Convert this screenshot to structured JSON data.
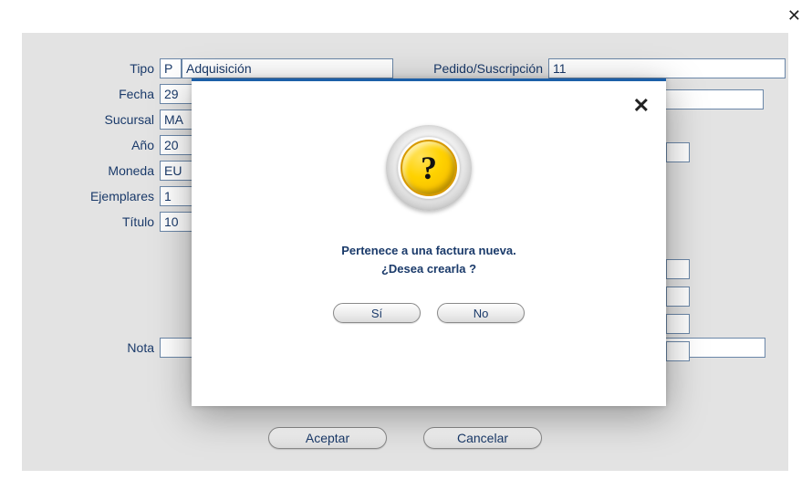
{
  "page": {
    "close_glyph": "✕"
  },
  "form": {
    "tipo_label": "Tipo",
    "tipo_value": "P",
    "tipo_desc": "Adquisición",
    "pedido_label": "Pedido/Suscripción",
    "pedido_value": "11",
    "fecha_label": "Fecha",
    "fecha_value": "29",
    "sucursal_label": "Sucursal",
    "sucursal_value": "MA",
    "ano_label": "Año",
    "ano_value": "20",
    "moneda_label": "Moneda",
    "moneda_value": "EU",
    "ejemplares_label": "Ejemplares",
    "ejemplares_value": "1",
    "titulo_label": "Título",
    "titulo_value": "10",
    "nota_label": "Nota",
    "nota_value": ""
  },
  "buttons": {
    "aceptar": "Aceptar",
    "cancelar": "Cancelar"
  },
  "dialog": {
    "line1": "Pertenece a una factura nueva.",
    "line2": "¿Desea crearla ?",
    "yes": "Sí",
    "no": "No",
    "icon_glyph": "?",
    "close_glyph": "✕"
  }
}
